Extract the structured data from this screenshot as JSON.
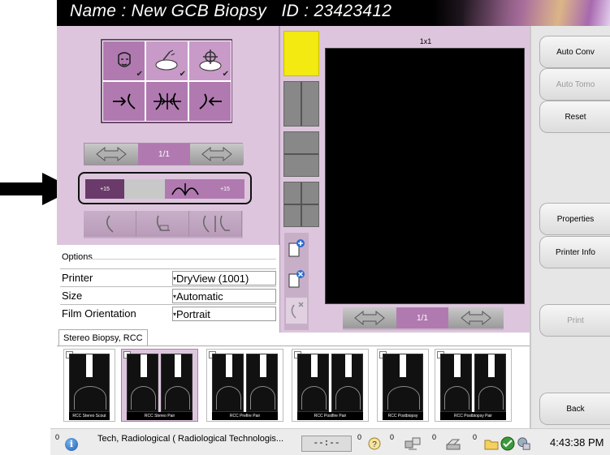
{
  "patient": {
    "name_label": "Name : New GCB Biopsy",
    "id_label": "ID : 23423412"
  },
  "navigator": {
    "page": "1/1"
  },
  "ruler": {
    "left_label": "+15",
    "right_label": "+15"
  },
  "options": {
    "title": "Options",
    "rows": [
      {
        "label": "Printer",
        "value": "DryView (1001)"
      },
      {
        "label": "Size",
        "value": "Automatic"
      },
      {
        "label": "Film Orientation",
        "value": "Portrait"
      }
    ]
  },
  "viewer": {
    "layout_label": "1x1",
    "page": "1/1"
  },
  "right_buttons": {
    "auto_conv": "Auto Conv",
    "auto_tomo": "Auto Tomo",
    "reset": "Reset",
    "properties": "Properties",
    "printer_info": "Printer Info",
    "print": "Print",
    "back": "Back"
  },
  "tab": {
    "label": "Stereo Biopsy, RCC"
  },
  "thumbnails": [
    {
      "caption": "RCC Stereo Scout"
    },
    {
      "caption": "RCC Stereo Pair"
    },
    {
      "caption": "RCC Prefire Pair"
    },
    {
      "caption": "RCC Postfire Pair"
    },
    {
      "caption": "RCC Postbiopsy"
    },
    {
      "caption": "RCC Postbiopsy Pair"
    }
  ],
  "status": {
    "counter_1": "0",
    "user": "Tech, Radiological ( Radiological Technologis...",
    "timer": "--:--",
    "counter_2": "0",
    "counter_3": "0",
    "counter_4": "0",
    "counter_5": "0",
    "time": "4:43:38 PM"
  },
  "colors": {
    "panel": "#ddc6dd",
    "accent": "#b07ab0",
    "selected_cell": "#f2ea10"
  }
}
